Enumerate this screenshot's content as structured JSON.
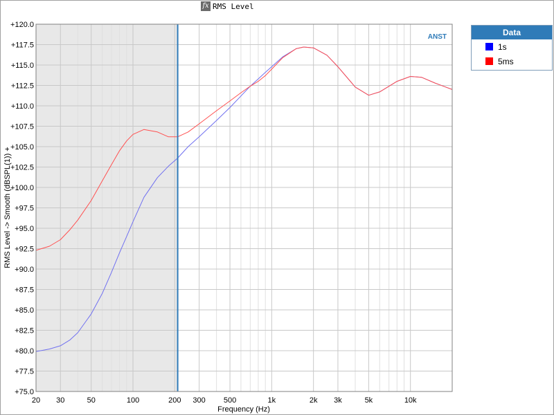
{
  "window": {
    "title": "RMS Level",
    "fx_icon": "fx-icon"
  },
  "legend": {
    "header": "Data",
    "items": [
      {
        "label": "1s",
        "color": "#0000ff"
      },
      {
        "label": "5ms",
        "color": "#ff0000"
      }
    ]
  },
  "chart_data": {
    "type": "line",
    "title": "RMS Level",
    "xlabel": "Frequency (Hz)",
    "ylabel": "RMS Level -> Smooth (dBSPL(1)) +",
    "xscale": "log",
    "xlim": [
      20,
      20000
    ],
    "ylim": [
      75,
      120
    ],
    "x_tick_values": [
      20,
      30,
      50,
      100,
      200,
      300,
      500,
      1000,
      2000,
      3000,
      5000,
      10000
    ],
    "x_tick_labels": [
      "20",
      "30",
      "50",
      "100",
      "200",
      "300",
      "500",
      "1k",
      "2k",
      "3k",
      "5k",
      "10k"
    ],
    "y_tick_values": [
      75,
      77.5,
      80,
      82.5,
      85,
      87.5,
      90,
      92.5,
      95,
      97.5,
      100,
      102.5,
      105,
      107.5,
      110,
      112.5,
      115,
      117.5,
      120
    ],
    "y_tick_labels": [
      "+75.0",
      "+77.5",
      "+80.0",
      "+82.5",
      "+85.0",
      "+87.5",
      "+90.0",
      "+92.5",
      "+95.0",
      "+97.5",
      "+100.0",
      "+102.5",
      "+105.0",
      "+107.5",
      "+110.0",
      "+112.5",
      "+115.0",
      "+117.5",
      "+120.0"
    ],
    "grid": true,
    "legend_position": "top-right, outside plot",
    "annotation": "ANST",
    "shaded_region": {
      "x_from": 20,
      "x_to": 210,
      "color": "#e8e8e8"
    },
    "marker_line": {
      "x": 210,
      "color": "#2f7bb8"
    },
    "series": [
      {
        "name": "1s",
        "color": "#7070f0",
        "x": [
          20,
          25,
          30,
          35,
          40,
          50,
          60,
          70,
          80,
          90,
          100,
          120,
          150,
          180,
          210,
          250,
          300,
          400,
          500,
          600,
          700,
          800,
          900,
          1000,
          1200,
          1500,
          1700,
          2000,
          2500,
          3000,
          4000,
          5000,
          6000,
          7000,
          8000,
          10000,
          12000,
          15000,
          20000
        ],
        "y": [
          79.9,
          80.2,
          80.6,
          81.3,
          82.2,
          84.5,
          87.0,
          89.6,
          92.0,
          94.0,
          95.8,
          98.8,
          101.2,
          102.6,
          103.6,
          105.0,
          106.2,
          108.2,
          109.8,
          111.2,
          112.4,
          113.3,
          114.1,
          114.8,
          116.0,
          117.0,
          117.2,
          117.1,
          116.2,
          114.8,
          112.3,
          111.3,
          111.7,
          112.4,
          113.0,
          113.6,
          113.5,
          112.8,
          112.0
        ]
      },
      {
        "name": "5ms",
        "color": "#ff5050",
        "x": [
          20,
          25,
          30,
          35,
          40,
          50,
          60,
          70,
          80,
          90,
          100,
          120,
          150,
          180,
          210,
          250,
          300,
          400,
          500,
          600,
          700,
          800,
          900,
          1000,
          1200,
          1500,
          1700,
          2000,
          2500,
          3000,
          4000,
          5000,
          6000,
          7000,
          8000,
          10000,
          12000,
          15000,
          20000
        ],
        "y": [
          92.3,
          92.8,
          93.6,
          94.8,
          96.0,
          98.4,
          100.8,
          102.8,
          104.5,
          105.7,
          106.5,
          107.1,
          106.8,
          106.2,
          106.2,
          106.8,
          107.8,
          109.4,
          110.6,
          111.6,
          112.4,
          113.0,
          113.7,
          114.5,
          115.9,
          117.0,
          117.2,
          117.1,
          116.2,
          114.8,
          112.3,
          111.3,
          111.7,
          112.4,
          113.0,
          113.6,
          113.5,
          112.8,
          112.0
        ]
      }
    ]
  }
}
